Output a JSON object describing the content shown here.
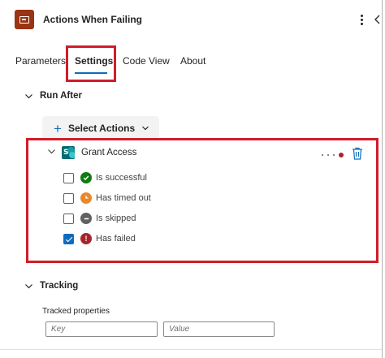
{
  "header": {
    "title": "Actions When Failing",
    "app_icon": "action-scope-icon",
    "more_icon": "more-vertical-icon",
    "collapse_icon": "chevron-left-icon"
  },
  "tabs": [
    {
      "label": "Parameters",
      "active": false
    },
    {
      "label": "Settings",
      "active": true
    },
    {
      "label": "Code View",
      "active": false
    },
    {
      "label": "About",
      "active": false
    }
  ],
  "run_after": {
    "section_label": "Run After",
    "select_actions_label": "Select Actions",
    "action": {
      "name": "Grant Access",
      "icon": "sharepoint-icon",
      "conditions": [
        {
          "label": "Is successful",
          "checked": false,
          "icon": "check-circle-icon",
          "color": "#107c10"
        },
        {
          "label": "Has timed out",
          "checked": false,
          "icon": "clock-icon",
          "color": "#e8892c"
        },
        {
          "label": "Is skipped",
          "checked": false,
          "icon": "skip-circle-icon",
          "color": "#616161"
        },
        {
          "label": "Has failed",
          "checked": true,
          "icon": "error-circle-icon",
          "color": "#a4262c"
        }
      ]
    }
  },
  "tracking": {
    "section_label": "Tracking",
    "tracked_properties_label": "Tracked properties",
    "key_placeholder": "Key",
    "value_placeholder": "Value"
  },
  "colors": {
    "accent": "#0f6cbd",
    "highlight": "#d01c2a",
    "app_icon_bg": "#9a3412"
  }
}
